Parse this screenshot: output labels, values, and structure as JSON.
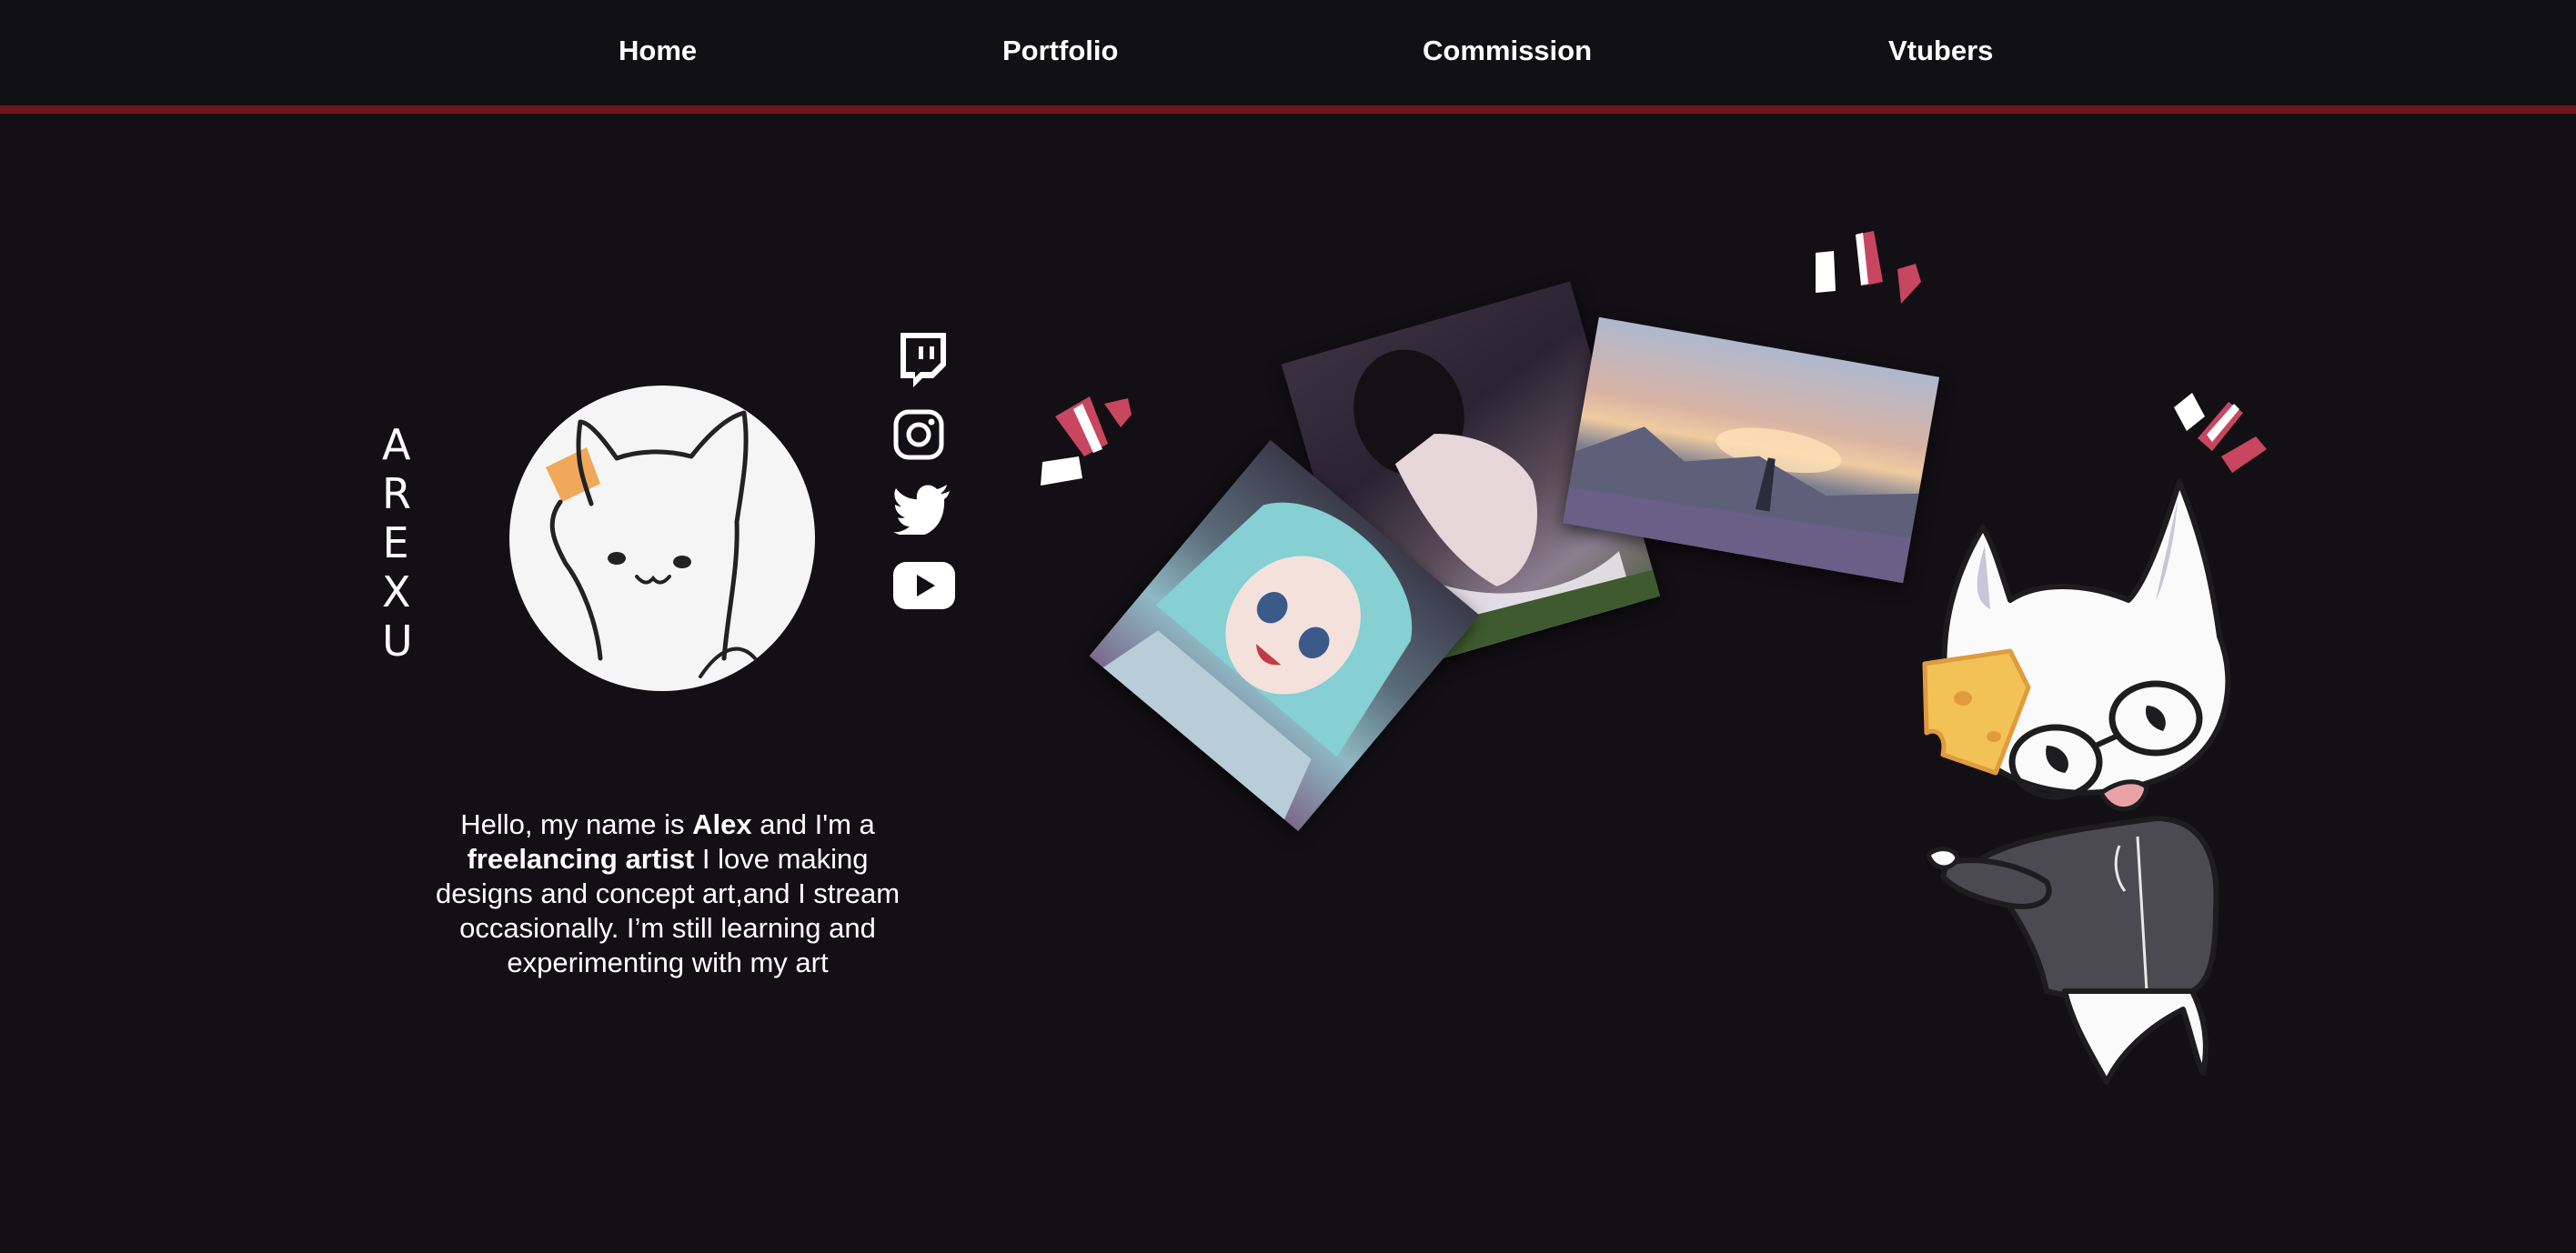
{
  "nav": {
    "items": [
      "Home",
      "Portfolio",
      "Commission",
      "Vtubers"
    ]
  },
  "brand": {
    "letters": [
      "A",
      "R",
      "E",
      "X",
      "U"
    ]
  },
  "social": {
    "icons": [
      "twitch-icon",
      "instagram-icon",
      "twitter-icon",
      "youtube-icon"
    ]
  },
  "bio": {
    "part1": "Hello, my name is ",
    "name": "Alex",
    "part2": " and I'm a ",
    "role": "freelancing artist",
    "part3": " I love making designs and concept art,and I stream occasionally. I’m still learning and experimenting with my art"
  },
  "colors": {
    "background": "#131015",
    "accent": "#6e1719",
    "pink": "#c8465f",
    "cheese": "#f0a95a"
  }
}
